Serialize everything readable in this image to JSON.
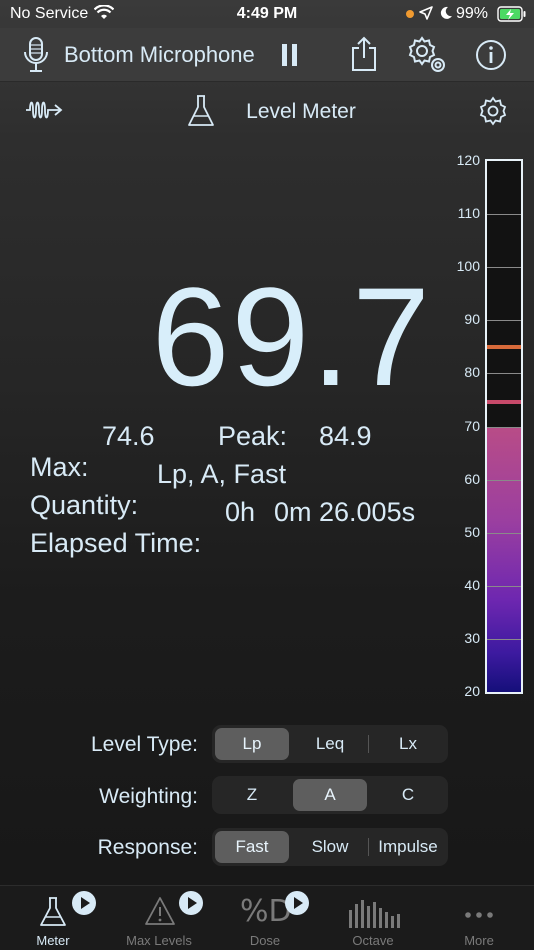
{
  "status_bar": {
    "carrier": "No Service",
    "time": "4:49 PM",
    "battery": "99%"
  },
  "toolbar": {
    "title": "Bottom Microphone",
    "icons": [
      "microphone-icon",
      "pause-icon",
      "share-icon",
      "settings-gear-icon",
      "info-icon"
    ]
  },
  "subbar": {
    "title": "Level Meter",
    "icons": [
      "waveform-icon",
      "flask-icon",
      "gear-icon"
    ]
  },
  "reading": {
    "value": "69.7"
  },
  "stats": {
    "max_label": "Max:",
    "max_value": "74.6",
    "peak_label": "Peak:",
    "peak_value": "84.9",
    "quantity_label": "Quantity:",
    "quantity_value": "Lp, A, Fast",
    "elapsed_label": "Elapsed Time:",
    "elapsed_hours": "0h",
    "elapsed_rest": "0m 26.005s"
  },
  "meter": {
    "scale": [
      "120",
      "110",
      "100",
      "90",
      "80",
      "70",
      "60",
      "50",
      "40",
      "30",
      "20"
    ],
    "min": 20,
    "max": 120,
    "level": 69.7,
    "max_marker": 74.6,
    "peak_marker": 84.9,
    "max_marker_color": "#c84a6a",
    "peak_marker_color": "#d86a3a"
  },
  "controls": {
    "level_type": {
      "label": "Level Type:",
      "options": [
        "Lp",
        "Leq",
        "Lx"
      ],
      "selected": "Lp"
    },
    "weighting": {
      "label": "Weighting:",
      "options": [
        "Z",
        "A",
        "C"
      ],
      "selected": "A"
    },
    "response": {
      "label": "Response:",
      "options": [
        "Fast",
        "Slow",
        "Impulse"
      ],
      "selected": "Fast"
    }
  },
  "tabs": [
    {
      "label": "Meter",
      "active": true,
      "icon": "flask-icon"
    },
    {
      "label": "Max Levels",
      "active": false,
      "icon": "warning-icon"
    },
    {
      "label": "Dose",
      "active": false,
      "icon": "dose-icon"
    },
    {
      "label": "Octave",
      "active": false,
      "icon": "octave-bars-icon"
    },
    {
      "label": "More",
      "active": false,
      "icon": "more-dots-icon"
    }
  ]
}
